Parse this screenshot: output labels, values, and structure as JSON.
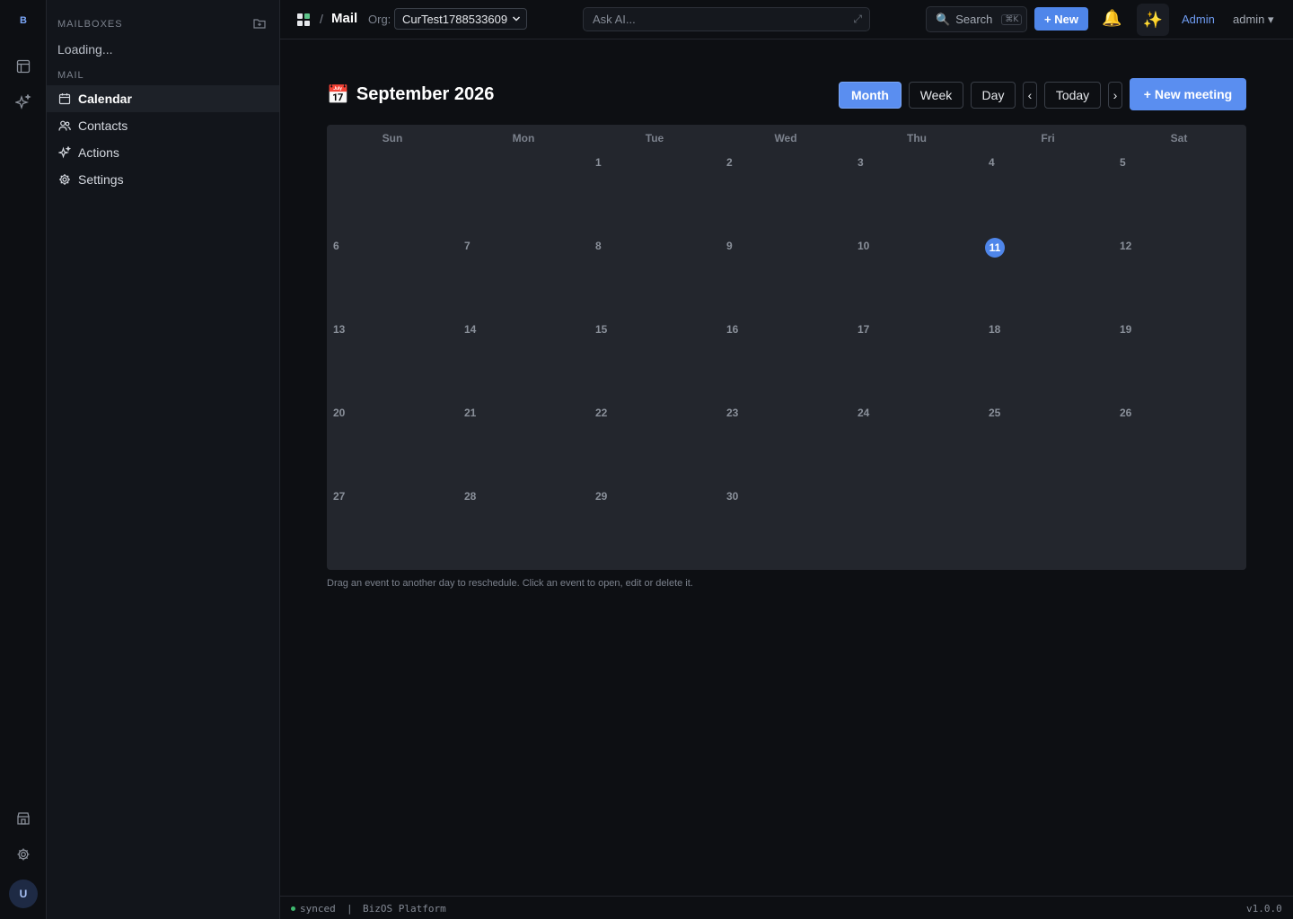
{
  "rail": {
    "logo": "B",
    "avatar": "U",
    "icons": [
      "table-icon",
      "sparkles-icon",
      "store-icon",
      "gear-icon"
    ]
  },
  "sidebar": {
    "mailboxes_label": "MAILBOXES",
    "loading_text": "Loading...",
    "mail_label": "MAIL",
    "items": [
      {
        "label": "Calendar",
        "icon": "calendar-icon",
        "active": true
      },
      {
        "label": "Contacts",
        "icon": "users-icon",
        "active": false
      },
      {
        "label": "Actions",
        "icon": "sparkles-icon",
        "active": false
      },
      {
        "label": "Settings",
        "icon": "gear-icon",
        "active": false
      }
    ]
  },
  "topbar": {
    "breadcrumb_sep": "/",
    "breadcrumb_current": "Mail",
    "org_label": "Org:",
    "org_value": "CurTest1788533609",
    "ask_ai_placeholder": "Ask AI...",
    "ask_ai_expand": "⤢",
    "search_label": "Search",
    "search_shortcut": "⌘K",
    "new_label": "+ New",
    "admin_label": "Admin",
    "user_label": "admin ▾"
  },
  "calendar": {
    "title_icon": "📅",
    "title": "September 2026",
    "views": [
      {
        "label": "Month",
        "active": true
      },
      {
        "label": "Week",
        "active": false
      },
      {
        "label": "Day",
        "active": false
      }
    ],
    "prev_label": "‹",
    "today_label": "Today",
    "next_label": "›",
    "new_meeting_label": "+ New meeting",
    "weekdays": [
      "Sun",
      "Mon",
      "Tue",
      "Wed",
      "Thu",
      "Fri",
      "Sat"
    ],
    "first_weekday_index": 2,
    "days_in_month": 30,
    "today": 11,
    "hint": "Drag an event to another day to reschedule. Click an event to open, edit or delete it."
  },
  "status": {
    "sync": "synced",
    "sep": "|",
    "platform": "BizOS Platform",
    "version": "v1.0.0"
  },
  "colors": {
    "accent": "#5a8ef0",
    "today": "#4f86ea",
    "synced": "#3fb96f"
  }
}
